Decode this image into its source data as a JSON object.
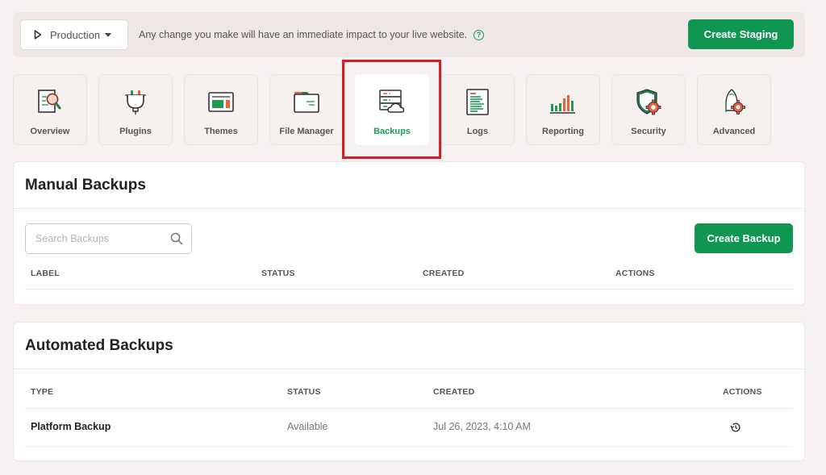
{
  "environment_bar": {
    "environment_select": {
      "value": "Production",
      "icon": "play-icon"
    },
    "message": "Any change you make will have an immediate impact to your live website.",
    "help_icon": "question-circle-icon",
    "create_staging_label": "Create Staging"
  },
  "nav": {
    "active": "Backups",
    "items": [
      {
        "label": "Overview",
        "icon": "document-search-icon"
      },
      {
        "label": "Plugins",
        "icon": "plug-icon"
      },
      {
        "label": "Themes",
        "icon": "layout-icon"
      },
      {
        "label": "File Manager",
        "icon": "folder-icon"
      },
      {
        "label": "Backups",
        "icon": "server-cloud-icon"
      },
      {
        "label": "Logs",
        "icon": "log-file-icon"
      },
      {
        "label": "Reporting",
        "icon": "bar-chart-icon"
      },
      {
        "label": "Security",
        "icon": "shield-gear-icon"
      },
      {
        "label": "Advanced",
        "icon": "rocket-gear-icon"
      }
    ]
  },
  "colors": {
    "accent_green": "#0f9650",
    "highlight_red": "#d2202a",
    "icon_orange": "#e8643f"
  },
  "manual_backups": {
    "title": "Manual Backups",
    "search": {
      "placeholder": "Search Backups",
      "value": ""
    },
    "create_backup_label": "Create Backup",
    "columns": [
      "LABEL",
      "STATUS",
      "CREATED",
      "ACTIONS"
    ],
    "rows": []
  },
  "automated_backups": {
    "title": "Automated Backups",
    "columns": [
      "TYPE",
      "STATUS",
      "CREATED",
      "ACTIONS"
    ],
    "rows": [
      {
        "type": "Platform Backup",
        "status": "Available",
        "created": "Jul 26, 2023, 4:10 AM",
        "action_icon": "restore-history-icon"
      }
    ]
  }
}
